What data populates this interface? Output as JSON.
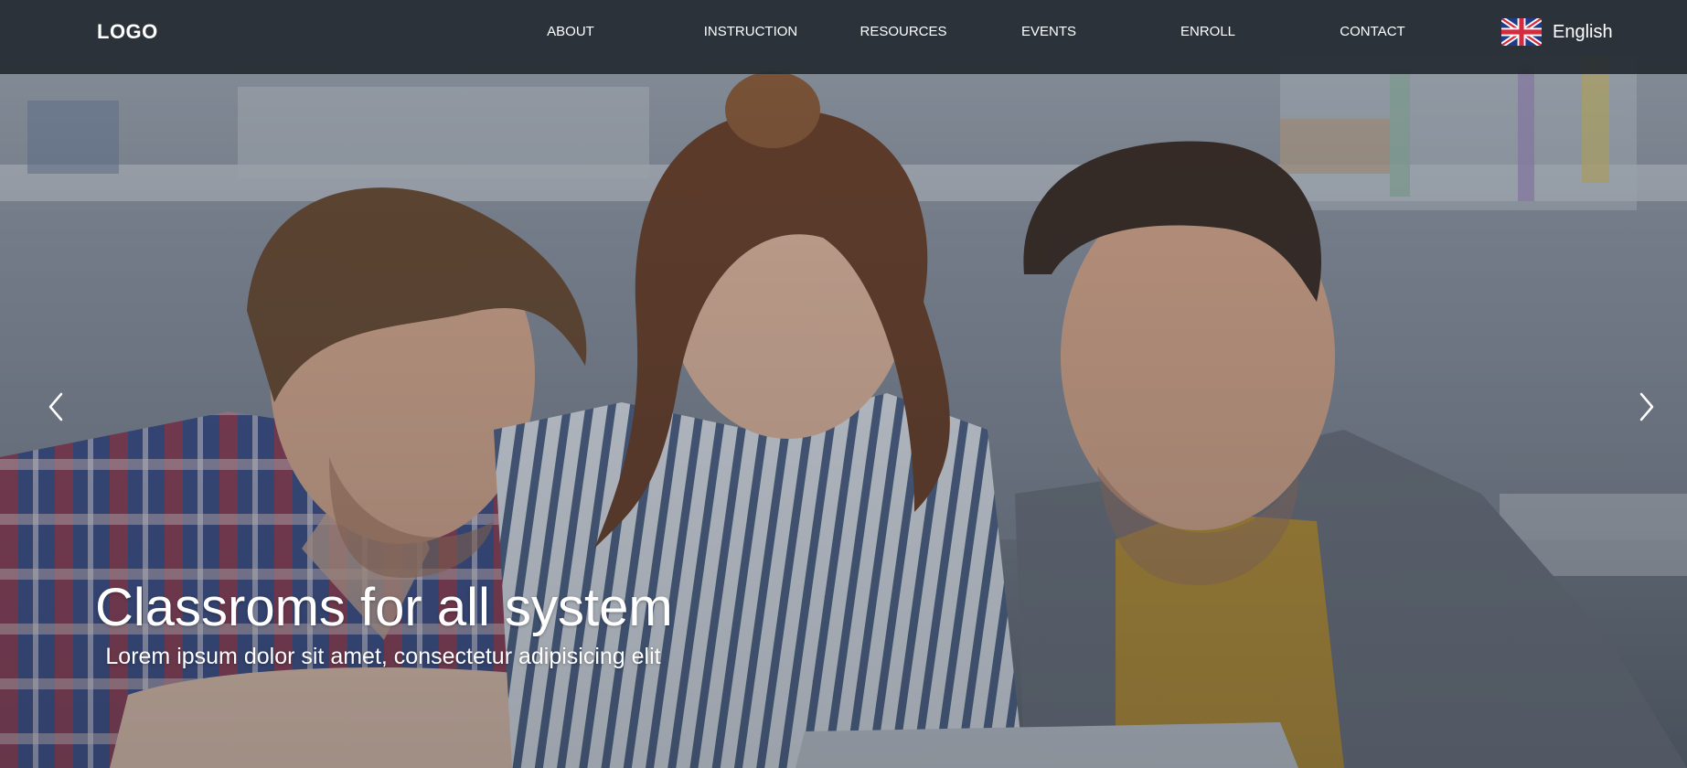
{
  "header": {
    "logo": "LOGO",
    "nav": [
      {
        "label": "ABOUT"
      },
      {
        "label": "INSTRUCTION"
      },
      {
        "label": "RESOURCES"
      },
      {
        "label": "EVENTS"
      },
      {
        "label": "ENROLL"
      },
      {
        "label": "CONTACT"
      }
    ],
    "language": {
      "label": "English",
      "flag_icon": "uk-flag-icon"
    }
  },
  "hero": {
    "title": "Classroms for all system",
    "subtitle": "Lorem ipsum dolor sit amet, consectetur adipisicing elit",
    "prev_icon": "chevron-left-icon",
    "next_icon": "chevron-right-icon"
  },
  "colors": {
    "navbar_bg": "#252b32",
    "text": "#ffffff"
  }
}
